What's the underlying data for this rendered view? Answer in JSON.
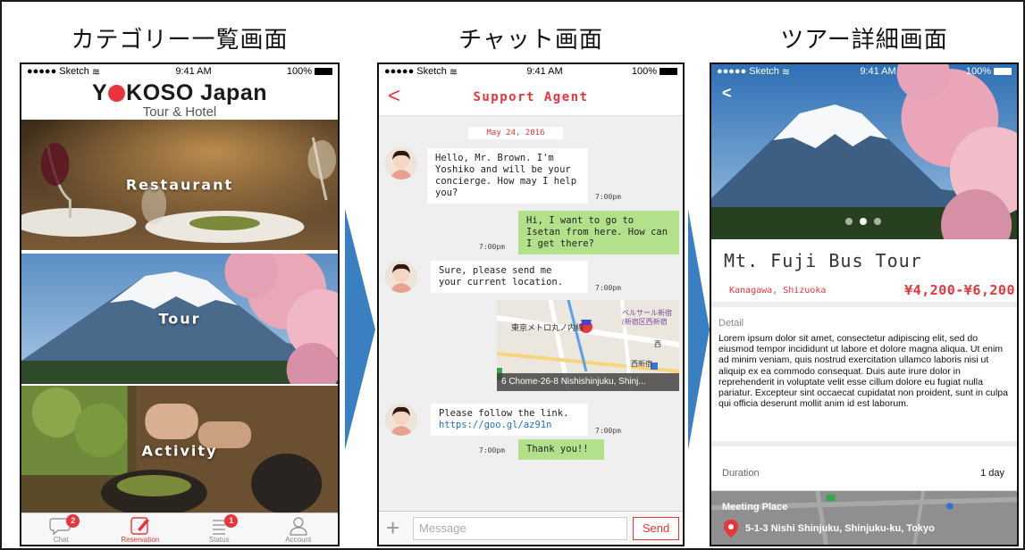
{
  "headings": {
    "category": "カテゴリー一覧画面",
    "chat": "チャット画面",
    "tour": "ツアー詳細画面"
  },
  "status_bar": {
    "carrier": "●●●●● Sketch",
    "time": "9:41 AM",
    "battery": "100%"
  },
  "category_screen": {
    "logo_main_before": "Y",
    "logo_main_after": "KOSO Japan",
    "logo_sub": "Tour & Hotel",
    "categories": [
      "Restaurant",
      "Tour",
      "Activity"
    ],
    "tabs": [
      {
        "label": "Chat",
        "badge": "2",
        "icon": "chat-bubble-icon"
      },
      {
        "label": "Reservation",
        "badge": "",
        "icon": "edit-icon",
        "active": true
      },
      {
        "label": "Status",
        "badge": "1",
        "icon": "list-icon"
      },
      {
        "label": "Account",
        "badge": "",
        "icon": "person-icon"
      }
    ],
    "accent": "#e8353b"
  },
  "chat_screen": {
    "back": "<",
    "title": "Support Agent",
    "date": "May 24, 2016",
    "messages": [
      {
        "from": "agent",
        "text": "Hello, Mr. Brown. I'm Yoshiko and will be your concierge. How may I help you?",
        "time": "7:00pm"
      },
      {
        "from": "user",
        "text": "Hi, I want to go to Isetan from here. How can I get there?",
        "time": "7:00pm"
      },
      {
        "from": "agent",
        "text": "Sure, please send me your current location.",
        "time": "7:00pm"
      },
      {
        "from": "agent",
        "type": "map",
        "caption": "6 Chome-26-8 Nishishinjuku, Shinj...",
        "map_label_1": "東京メトロ丸ノ内線",
        "map_label_2": "ベルサール新宿 (新宿区西新宿",
        "map_label_3": "西新宿",
        "map_label_4": "西",
        "time": ""
      },
      {
        "from": "agent",
        "text_before_link": "Please follow the link.",
        "link": "https://goo.gl/az91n",
        "time": "7:00pm"
      },
      {
        "from": "user",
        "text": "Thank you!!",
        "time": "7:00pm"
      }
    ],
    "composer": {
      "placeholder": "Message",
      "send": "Send",
      "plus": "+"
    },
    "bubble_out_color": "#b3e08b"
  },
  "tour_screen": {
    "back": "<",
    "name": "Mt. Fuji Bus Tour",
    "location": "Kanagawa, Shizuoka",
    "price": "¥4,200-¥6,200",
    "detail_heading": "Detail",
    "detail_text": "Lorem ipsum dolor sit amet, consectetur adipiscing elit, sed do eiusmod tempor incididunt ut labore et dolore magna aliqua. Ut enim ad minim veniam, quis nostrud exercitation ullamco laboris nisi ut aliquip ex ea commodo consequat. Duis aute irure dolor in reprehenderit in voluptate velit esse cillum dolore eu fugiat nulla pariatur. Excepteur sint occaecat cupidatat non proident, sunt in culpa qui officia deserunt mollit anim id est laborum.",
    "duration_label": "Duration",
    "duration_value": "1 day",
    "meeting_label": "Meeting Place",
    "meeting_address": "5-1-3 Nishi Shinjuku, Shinjuku-ku, Tokyo",
    "carousel": {
      "count": 3,
      "active": 1
    }
  }
}
